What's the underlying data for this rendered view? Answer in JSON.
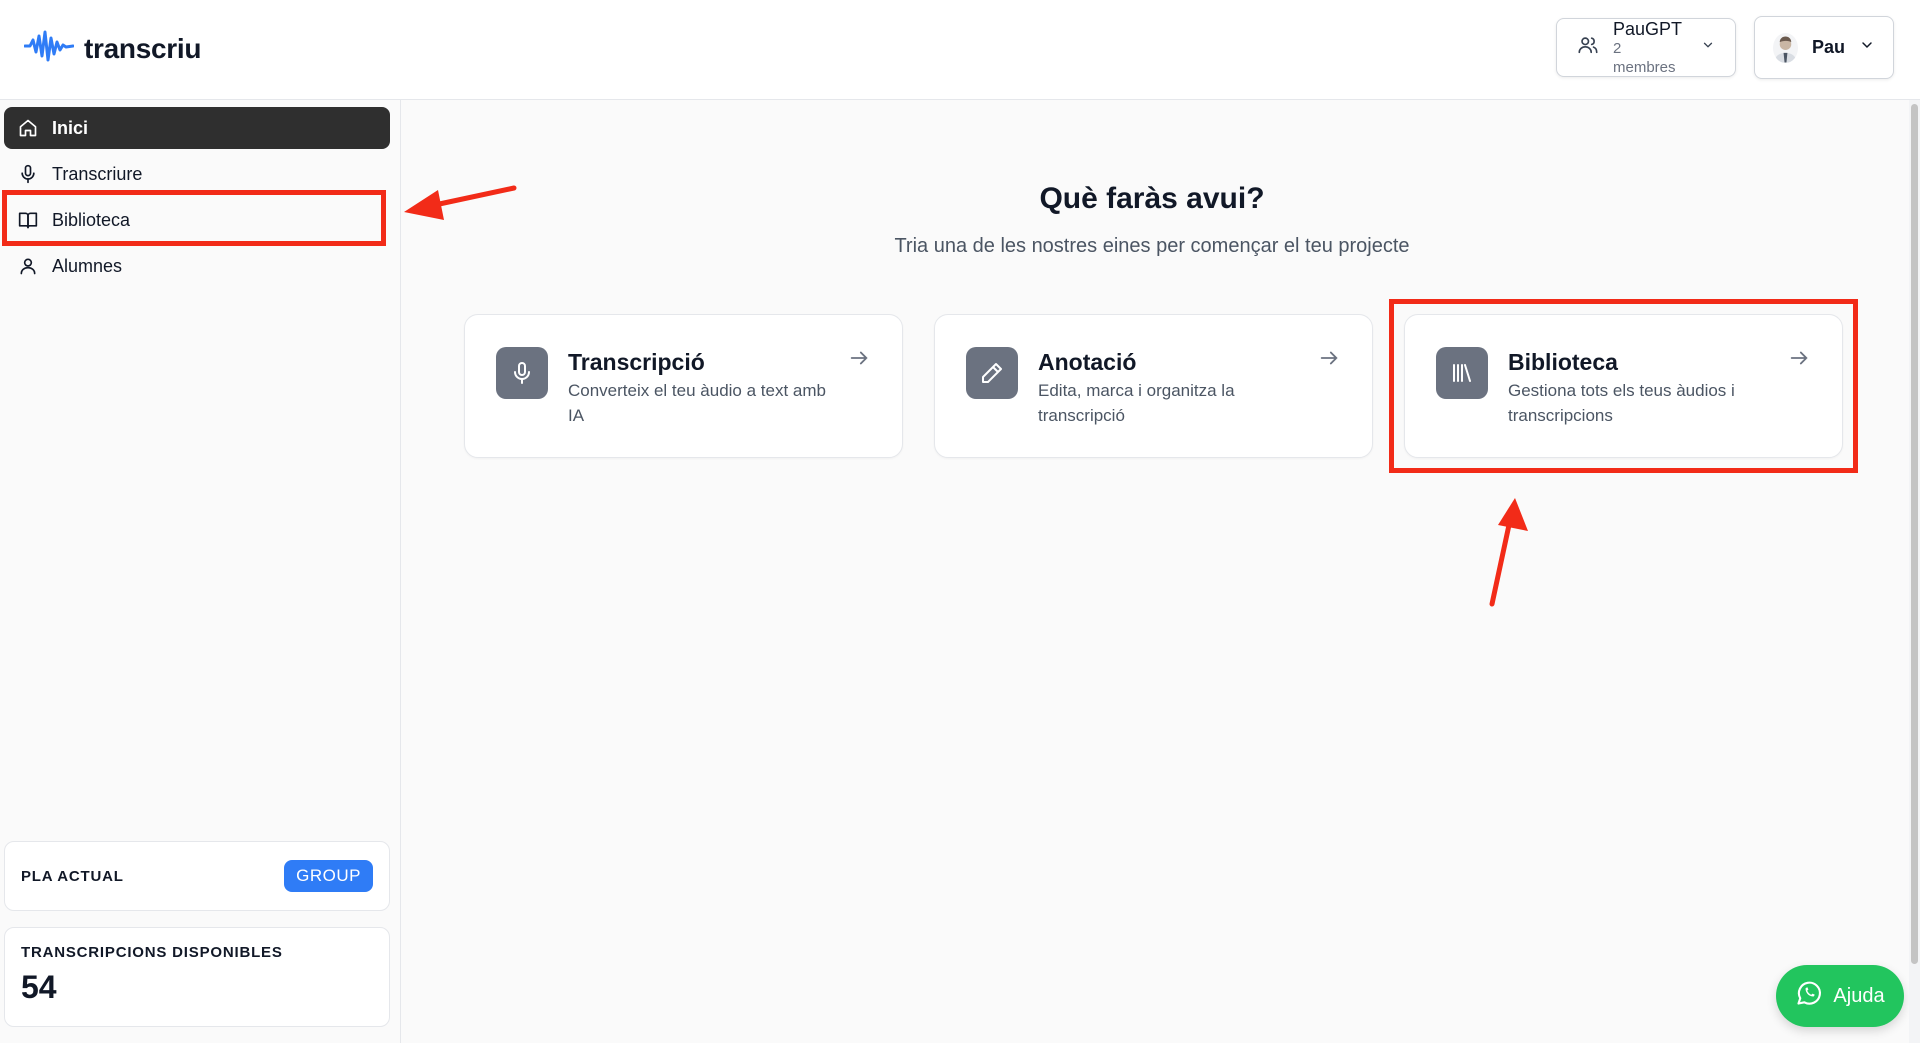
{
  "header": {
    "logo_text": "transcriu",
    "team": {
      "name": "PauGPT",
      "members": "2 membres"
    },
    "user": {
      "name": "Pau"
    }
  },
  "sidebar": {
    "items": [
      {
        "label": "Inici",
        "icon": "home-icon",
        "active": true
      },
      {
        "label": "Transcriure",
        "icon": "microphone-icon",
        "active": false
      },
      {
        "label": "Biblioteca",
        "icon": "book-icon",
        "active": false
      },
      {
        "label": "Alumnes",
        "icon": "user-icon",
        "active": false
      }
    ],
    "plan": {
      "label": "PLA ACTUAL",
      "badge": "GROUP"
    },
    "available": {
      "label": "TRANSCRIPCIONS DISPONIBLES",
      "value": "54"
    }
  },
  "main": {
    "title": "Què faràs avui?",
    "subtitle": "Tria una de les nostres eines per començar el teu projecte",
    "cards": [
      {
        "title": "Transcripció",
        "description": "Converteix el teu àudio a text amb IA",
        "icon": "microphone-icon"
      },
      {
        "title": "Anotació",
        "description": "Edita, marca i organitza la transcripció",
        "icon": "pencil-icon"
      },
      {
        "title": "Biblioteca",
        "description": "Gestiona tots els teus àudios i transcripcions",
        "icon": "library-icon"
      }
    ]
  },
  "help_button": {
    "label": "Ajuda",
    "icon": "whatsapp-icon"
  },
  "colors": {
    "accent": "#2f7cf6",
    "active_nav": "#2f2f2f",
    "help_green": "#22c55e",
    "annotation_red": "#f22b18",
    "card_icon_bg": "#6b7280"
  }
}
